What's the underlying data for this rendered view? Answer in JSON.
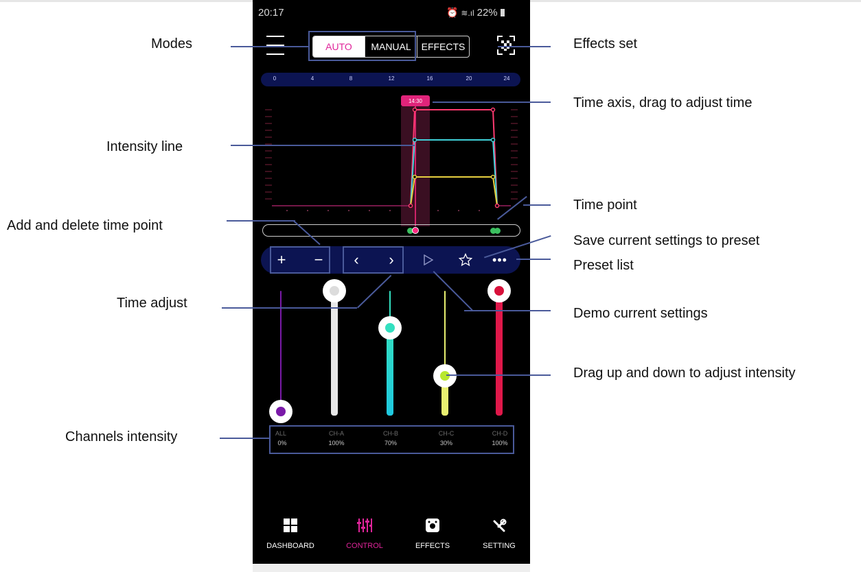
{
  "status_bar": {
    "time": "20:17",
    "battery": "22%"
  },
  "mode_tabs": [
    {
      "label": "AUTO",
      "active": true
    },
    {
      "label": "MANUAL",
      "active": false
    },
    {
      "label": "EFFECTS",
      "active": false
    }
  ],
  "time_axis": {
    "ticks": [
      "0",
      "4",
      "8",
      "12",
      "16",
      "20",
      "24"
    ],
    "current_time": "14:30"
  },
  "channels": [
    {
      "name": "ALL",
      "value": "0%",
      "color": "#7a1aa8"
    },
    {
      "name": "CH-A",
      "value": "100%",
      "color": "#e8e8e8"
    },
    {
      "name": "CH-B",
      "value": "70%",
      "color": "#33e0c0"
    },
    {
      "name": "CH-C",
      "value": "30%",
      "color": "#e8f070"
    },
    {
      "name": "CH-D",
      "value": "100%",
      "color": "#e0184a"
    }
  ],
  "bottom_nav": [
    {
      "label": "DASHBOARD",
      "icon": "grid-icon",
      "active": false
    },
    {
      "label": "CONTROL",
      "icon": "sliders-icon",
      "active": true
    },
    {
      "label": "EFFECTS",
      "icon": "effects-icon",
      "active": false
    },
    {
      "label": "SETTING",
      "icon": "tools-icon",
      "active": false
    }
  ],
  "annotations": {
    "modes": "Modes",
    "effects_set": "Effects set",
    "time_axis": "Time axis, drag to adjust time",
    "intensity_line": "Intensity line",
    "time_point": "Time point",
    "add_delete": "Add and delete time point",
    "save_preset": "Save current settings to preset",
    "preset_list": "Preset list",
    "time_adjust": "Time adjust",
    "demo": "Demo current settings",
    "drag_intensity": "Drag up and down to adjust intensity",
    "channels_intensity": "Channels intensity"
  },
  "colors": {
    "accent": "#e0249a",
    "toolbar_bg": "#0c1452",
    "annotation_line": "#4a5a9a"
  }
}
